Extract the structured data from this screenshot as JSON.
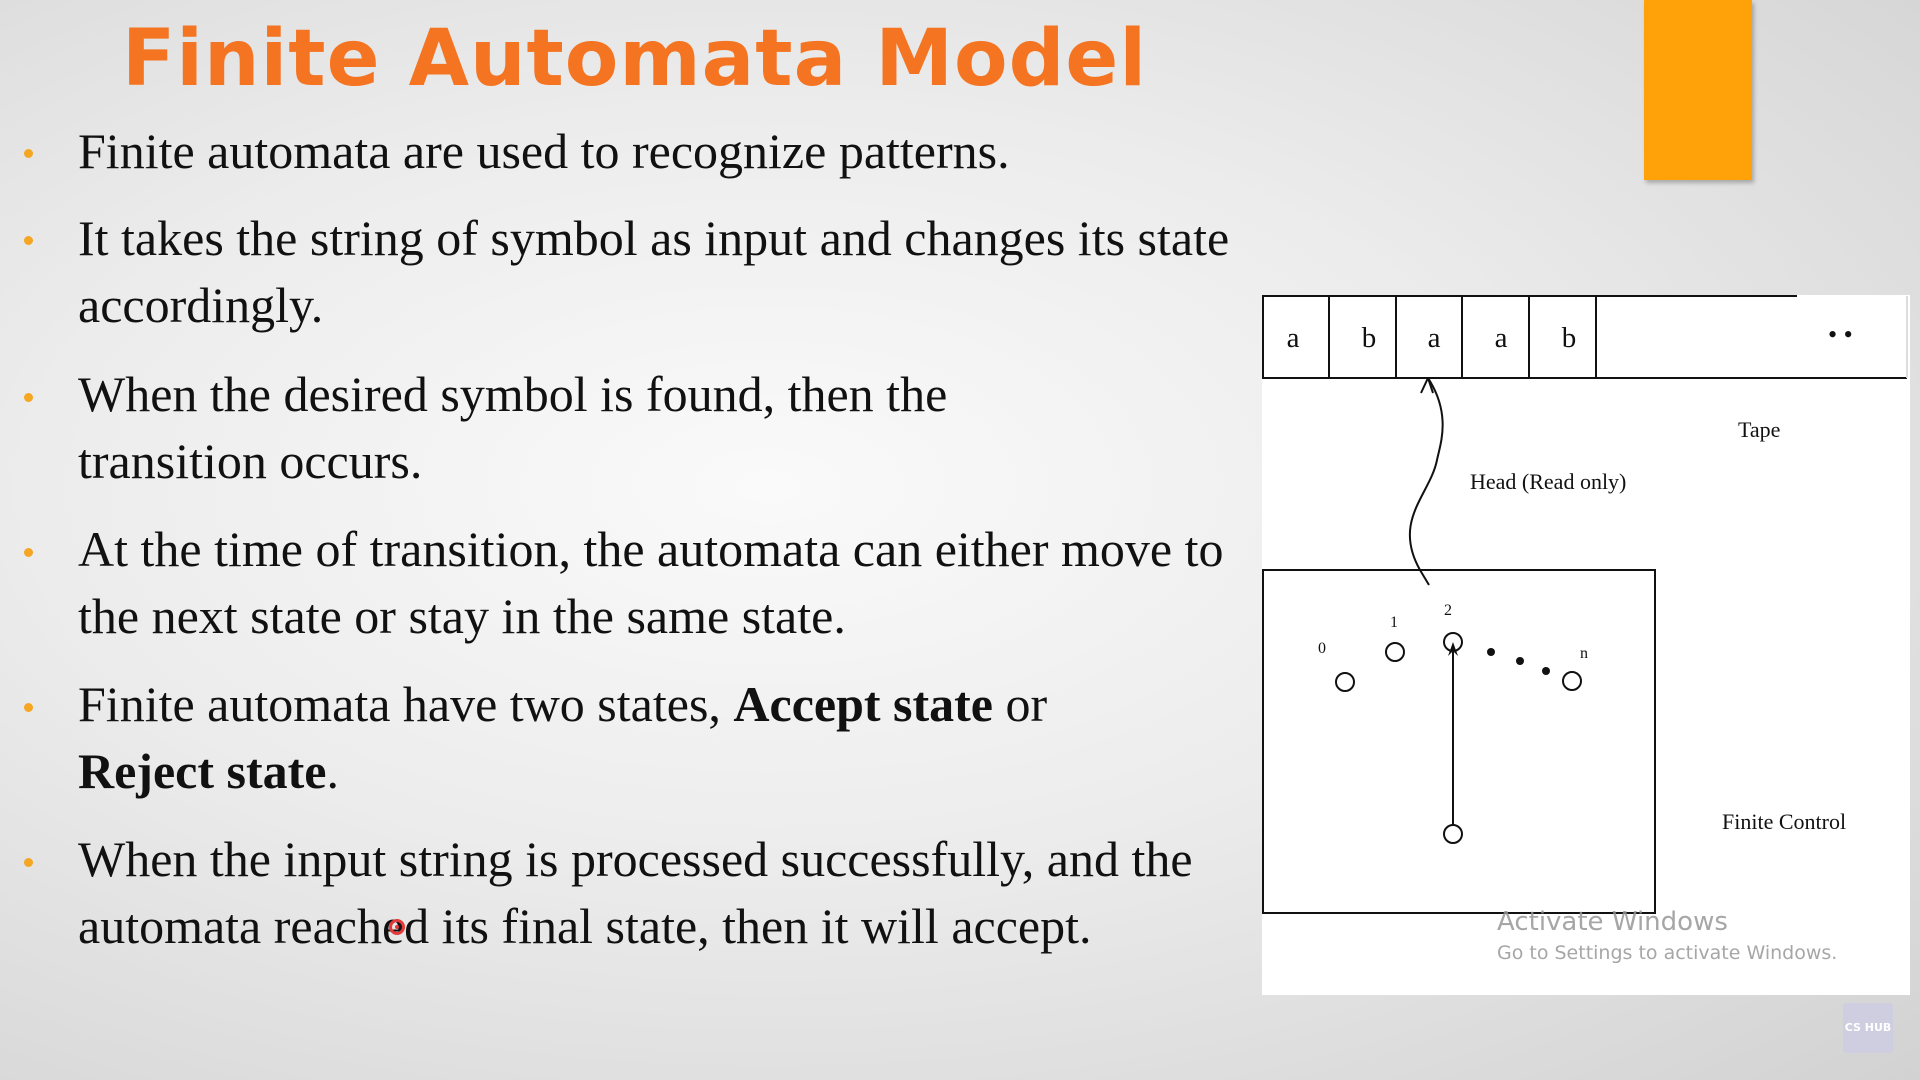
{
  "slide": {
    "title": "Finite Automata Model",
    "accent_color": "#f47421",
    "box_color": "#ffa20a"
  },
  "bullets": [
    {
      "parts": [
        {
          "text": "Finite automata are used to recognize patterns.",
          "bold": false
        }
      ]
    },
    {
      "parts": [
        {
          "text": "It takes the string of symbol as input and changes its state accordingly.",
          "bold": false
        }
      ]
    },
    {
      "parts": [
        {
          "text": " When the desired symbol is found, then the transition occurs.",
          "bold": false
        }
      ]
    },
    {
      "parts": [
        {
          "text": "At the time of transition, the automata can either move to the next state or stay in the same state.",
          "bold": false
        }
      ]
    },
    {
      "parts": [
        {
          "text": "Finite automata have two states, ",
          "bold": false
        },
        {
          "text": "Accept state",
          "bold": true
        },
        {
          "text": " or ",
          "bold": false
        },
        {
          "text": "Reject state",
          "bold": true
        },
        {
          "text": ".",
          "bold": false
        }
      ]
    },
    {
      "parts": [
        {
          "text": "When the input string is processed successfully, and the automata reached its final state, then it will accept.",
          "bold": false
        }
      ]
    }
  ],
  "diagram": {
    "tape_cells": [
      "a",
      "b",
      "a",
      "a",
      "b"
    ],
    "tape_ellipsis": "• •",
    "tape_label": "Tape",
    "head_label": "Head (Read only)",
    "control_label": "Finite Control",
    "state_labels": [
      "0",
      "1",
      "2",
      "n"
    ]
  },
  "watermark": {
    "title": "Activate Windows",
    "subtitle": "Go to Settings to activate Windows."
  },
  "logo_text": "CS HUB"
}
